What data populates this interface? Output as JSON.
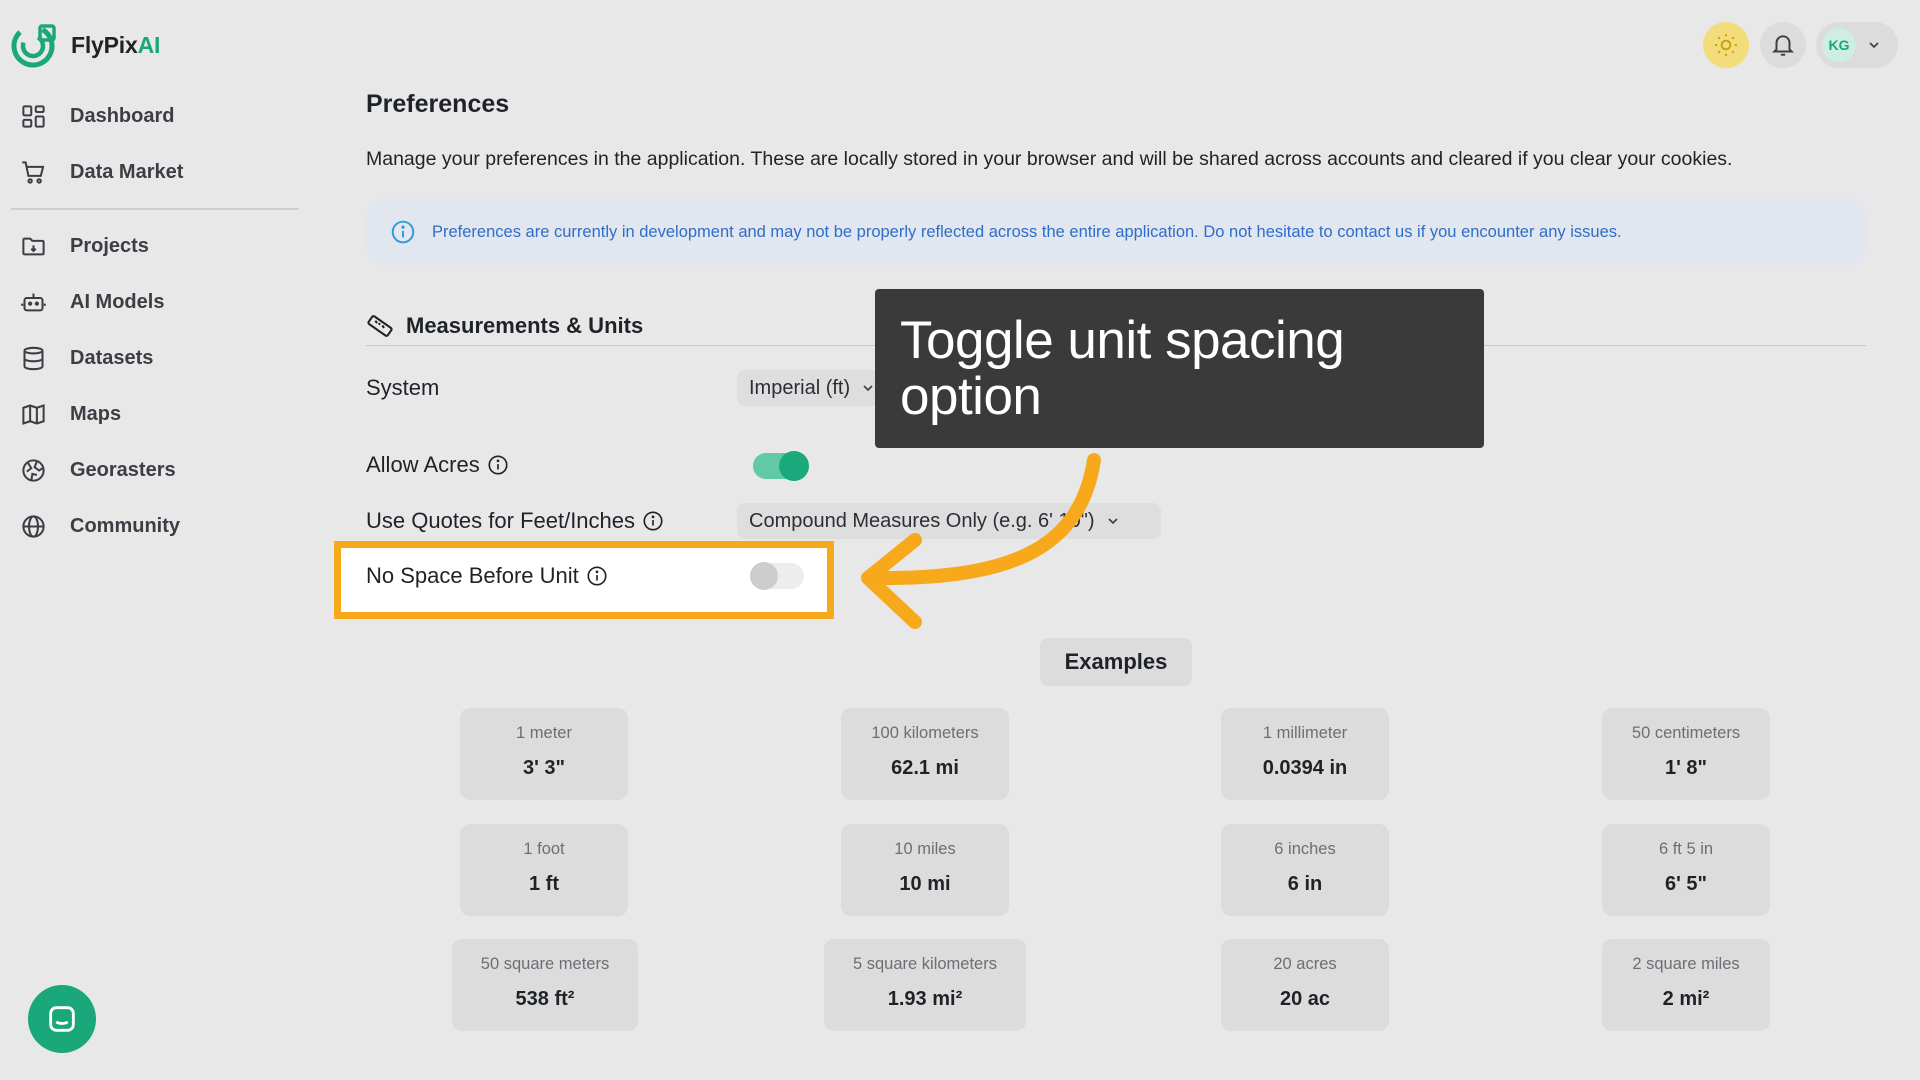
{
  "app": {
    "logo_text": "FlyPix",
    "logo_accent": "AI",
    "brand_color": "#1aa87a"
  },
  "sidebar": {
    "items": [
      {
        "label": "Dashboard",
        "icon": "dashboard-icon"
      },
      {
        "label": "Data Market",
        "icon": "cart-icon"
      },
      {
        "label": "Projects",
        "icon": "folder-icon"
      },
      {
        "label": "AI Models",
        "icon": "robot-icon"
      },
      {
        "label": "Datasets",
        "icon": "database-icon"
      },
      {
        "label": "Maps",
        "icon": "map-icon"
      },
      {
        "label": "Georasters",
        "icon": "globe-grid-icon"
      },
      {
        "label": "Community",
        "icon": "globe-icon"
      }
    ]
  },
  "header": {
    "avatar_initials": "KG"
  },
  "page": {
    "title": "Preferences",
    "description": "Manage your preferences in the application. These are locally stored in your browser and will be shared across accounts and cleared if you clear your cookies.",
    "info_notice": "Preferences are currently in development and may not be properly reflected across the entire application. Do not hesitate to contact us if you encounter any issues."
  },
  "measurements": {
    "section_title": "Measurements & Units",
    "system": {
      "label": "System",
      "value": "Imperial (ft)"
    },
    "allow_acres": {
      "label": "Allow Acres",
      "enabled": true
    },
    "quotes": {
      "label": "Use Quotes for Feet/Inches",
      "value": "Compound Measures Only (e.g. 6' 10\")"
    },
    "no_space": {
      "label": "No Space Before Unit",
      "enabled": false
    }
  },
  "examples": {
    "button_label": "Examples",
    "cards": [
      {
        "label": "1 meter",
        "value": "3' 3\""
      },
      {
        "label": "100 kilometers",
        "value": "62.1 mi"
      },
      {
        "label": "1 millimeter",
        "value": "0.0394 in"
      },
      {
        "label": "50 centimeters",
        "value": "1' 8\""
      },
      {
        "label": "1 foot",
        "value": "1 ft"
      },
      {
        "label": "10 miles",
        "value": "10 mi"
      },
      {
        "label": "6 inches",
        "value": "6 in"
      },
      {
        "label": "6 ft 5 in",
        "value": "6' 5\""
      },
      {
        "label": "50 square meters",
        "value": "538 ft²"
      },
      {
        "label": "5 square kilometers",
        "value": "1.93 mi²"
      },
      {
        "label": "20 acres",
        "value": "20 ac"
      },
      {
        "label": "2 square miles",
        "value": "2 mi²"
      }
    ]
  },
  "annotation": {
    "tooltip_text": "Toggle unit spacing option",
    "highlight_color": "#f7a81b"
  }
}
